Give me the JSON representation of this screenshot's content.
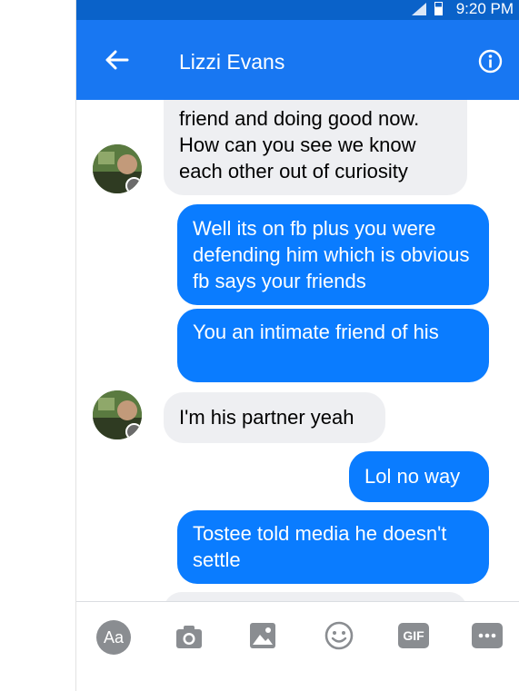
{
  "status_bar": {
    "time": "9:20 PM"
  },
  "header": {
    "contact_name": "Lizzi Evans"
  },
  "messages": [
    {
      "from": "them",
      "text": "friend and doing good now. How can you see we know each other out of curiosity"
    },
    {
      "from": "me",
      "text": "Well its on fb plus you were defending him which is obvious fb says your friends"
    },
    {
      "from": "me",
      "text": "You an intimate friend of his"
    },
    {
      "from": "them",
      "text": "I'm his partner yeah"
    },
    {
      "from": "me",
      "text": "Lol no way"
    },
    {
      "from": "me",
      "text": "Tostee told media he doesn't settle"
    }
  ],
  "composer": {
    "aa_label": "Aa",
    "gif_label": "GIF"
  },
  "icons": [
    "back-arrow-icon",
    "info-icon",
    "camera-icon",
    "gallery-icon",
    "emoji-icon",
    "gif-icon",
    "more-icon"
  ],
  "colors": {
    "header_blue": "#1877f2",
    "status_bar_blue": "#0a62c9",
    "outgoing_bubble": "#0a7cff",
    "incoming_bubble": "#eeeff2",
    "icon_gray": "#8a8d91"
  }
}
